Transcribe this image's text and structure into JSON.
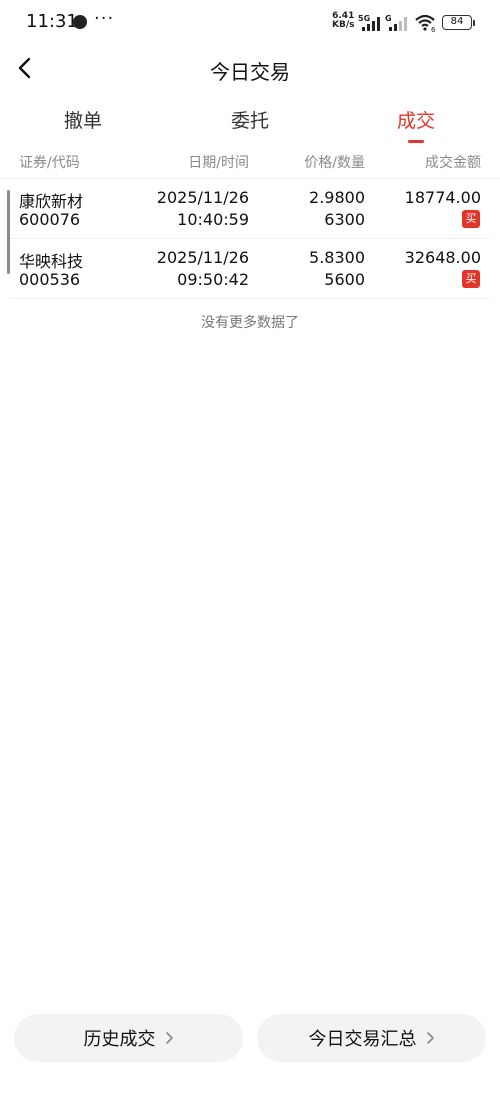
{
  "status_bar": {
    "time": "11:31",
    "more": "···",
    "speed_value": "6.41",
    "speed_unit": "KB/s",
    "network_label": "5G",
    "network_label2": "G",
    "wifi_sub": "6",
    "battery": "84"
  },
  "nav": {
    "title": "今日交易"
  },
  "tabs": [
    {
      "label": "撤单",
      "active": false
    },
    {
      "label": "委托",
      "active": false
    },
    {
      "label": "成交",
      "active": true
    }
  ],
  "columns": {
    "security": "证券/代码",
    "datetime": "日期/时间",
    "price_qty": "价格/数量",
    "amount": "成交金额"
  },
  "rows": [
    {
      "name": "康欣新材",
      "code": "600076",
      "date": "2025/11/26",
      "time": "10:40:59",
      "price": "2.9800",
      "quantity": "6300",
      "amount": "18774.00",
      "side": "买"
    },
    {
      "name": "华映科技",
      "code": "000536",
      "date": "2025/11/26",
      "time": "09:50:42",
      "price": "5.8300",
      "quantity": "5600",
      "amount": "32648.00",
      "side": "买"
    }
  ],
  "footer_note": "没有更多数据了",
  "buttons": {
    "history": "历史成交",
    "summary": "今日交易汇总"
  },
  "colors": {
    "accent": "#e4352b",
    "muted": "#8a8a8a",
    "button_bg": "#f2f3f5"
  }
}
